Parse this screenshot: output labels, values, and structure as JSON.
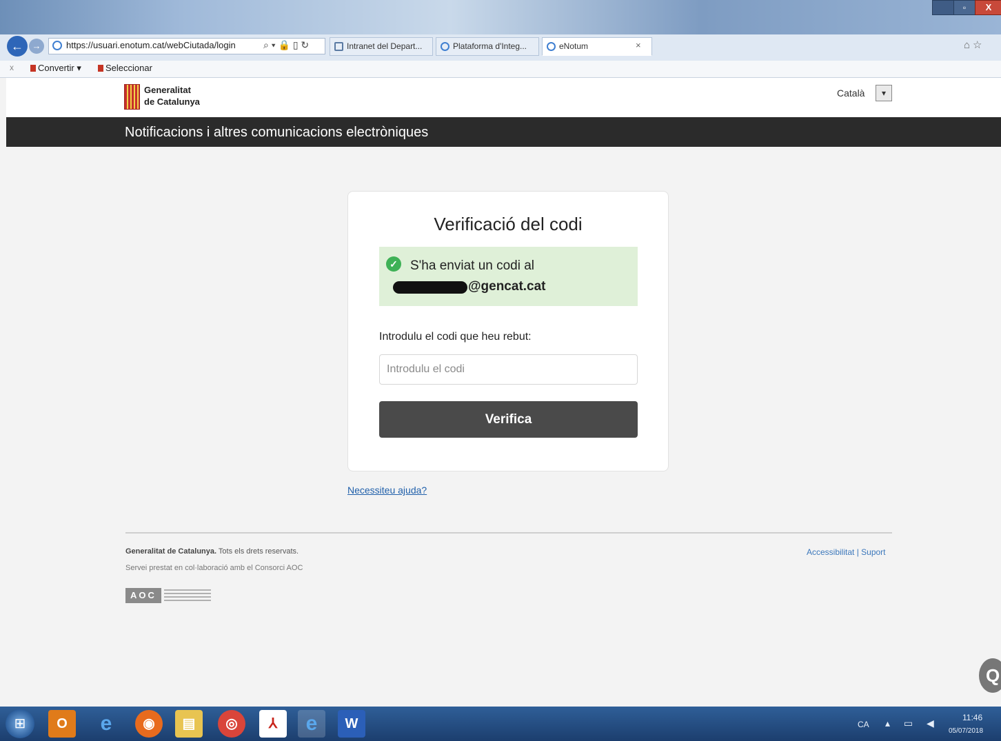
{
  "browser": {
    "window_buttons": {
      "maximize": "▫",
      "close": "X"
    },
    "nav": {
      "back_glyph": "←",
      "forward_glyph": "→"
    },
    "address_bar": {
      "url": "https://usuari.enotum.cat/webCiutada/login",
      "tools": "⌕ ▾ 🔒 ▯ ↻"
    },
    "tabs": [
      {
        "label": "Intranet del Depart..."
      },
      {
        "label": "Plataforma d'Integ..."
      },
      {
        "label": "eNotum",
        "close": "×"
      }
    ],
    "home_star": "⌂☆",
    "command_bar": {
      "close": "x",
      "convert": "Convertir ▾",
      "select": "Seleccionar"
    }
  },
  "header": {
    "brand_line1": "Generalitat",
    "brand_line2": "de Catalunya",
    "language": "Català",
    "language_arrow": "▾"
  },
  "service_title": "Notificacions i altres comunicacions electròniques",
  "verification": {
    "title": "Verificació del codi",
    "check_glyph": "✓",
    "alert_line1": "S'ha enviat un codi al",
    "email_domain": "@gencat.cat",
    "code_label": "Introdulu el codi que heu rebut:",
    "code_placeholder": "Introdulu el codi",
    "code_value": "",
    "verify_button": "Verifica"
  },
  "help_link": "Necessiteu ajuda?",
  "footer": {
    "org": "Generalitat de Catalunya.",
    "rights": " Tots els drets reservats.",
    "line2": "Servei prestat en col·laboració amb el Consorci AOC",
    "aoc_logo": "AOC",
    "links": "Accessibilitat | Suport"
  },
  "side_widget": "Q",
  "taskbar": {
    "start_glyph": "⊞",
    "apps": [
      {
        "name": "outlook",
        "label": "O"
      },
      {
        "name": "internet-explorer",
        "label": "e"
      },
      {
        "name": "firefox",
        "label": "◉"
      },
      {
        "name": "file-explorer",
        "label": "▤"
      },
      {
        "name": "chrome",
        "label": "◎"
      },
      {
        "name": "acrobat",
        "label": "⅄"
      },
      {
        "name": "internet-explorer",
        "label": "e"
      },
      {
        "name": "word",
        "label": "W"
      }
    ],
    "lang": "CA",
    "tray": "▴ ▭ ◀",
    "time": "11:46",
    "date": "05/07/2018"
  },
  "colors": {
    "dark_bar": "#2b2b2b",
    "alert_bg": "#dff0d8",
    "success": "#3eb156",
    "button_bg": "#4a4a4a",
    "link": "#1f5faa"
  }
}
